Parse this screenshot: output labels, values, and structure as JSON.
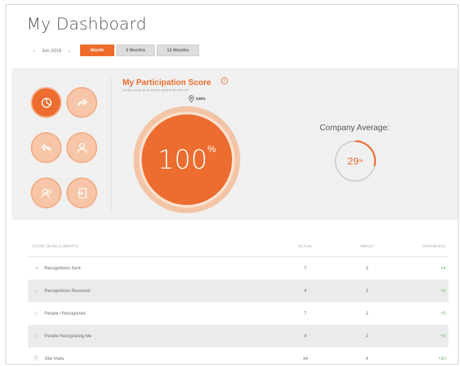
{
  "page": {
    "title": "My Dashboard"
  },
  "period": {
    "date": "Jun 2018",
    "prev_icon": "chevron-left-icon",
    "next_icon": "chevron-right-icon"
  },
  "tabs": [
    {
      "label": "Month",
      "active": true
    },
    {
      "label": "3 Months",
      "active": false
    },
    {
      "label": "12 Months",
      "active": false
    }
  ],
  "participation": {
    "title": "My Participation Score",
    "subtitle": "for this month as of JUN-21-2018 02:00 AM CST",
    "marker_label": "100%",
    "value": "100",
    "unit": "%"
  },
  "company_average": {
    "label": "Company Average:",
    "value": "29",
    "unit": "%",
    "fraction": 0.29
  },
  "score_table": {
    "headers": {
      "label": "SCORE DETAILS (MONTH)",
      "actual": "ACTUAL",
      "target": "TARGET",
      "difference": "DIFFERENCE"
    },
    "rows": [
      {
        "icon": "share-icon",
        "label": "Recognitions Sent",
        "actual": "7",
        "target": "3",
        "difference": "+4"
      },
      {
        "icon": "reply-icon",
        "label": "Recognitions Received",
        "actual": "4",
        "target": "2",
        "difference": "+2"
      },
      {
        "icon": "user-icon",
        "label": "People I Recognized",
        "actual": "7",
        "target": "2",
        "difference": "+5"
      },
      {
        "icon": "users-icon",
        "label": "People Recognizing Me",
        "actual": "4",
        "target": "2",
        "difference": "+2"
      },
      {
        "icon": "login-icon",
        "label": "Site Visits",
        "actual": "34",
        "target": "4",
        "difference": "+30"
      }
    ]
  },
  "colors": {
    "accent": "#ec6d2f",
    "positive": "#5cb85c",
    "panel": "#f0f0f0"
  }
}
